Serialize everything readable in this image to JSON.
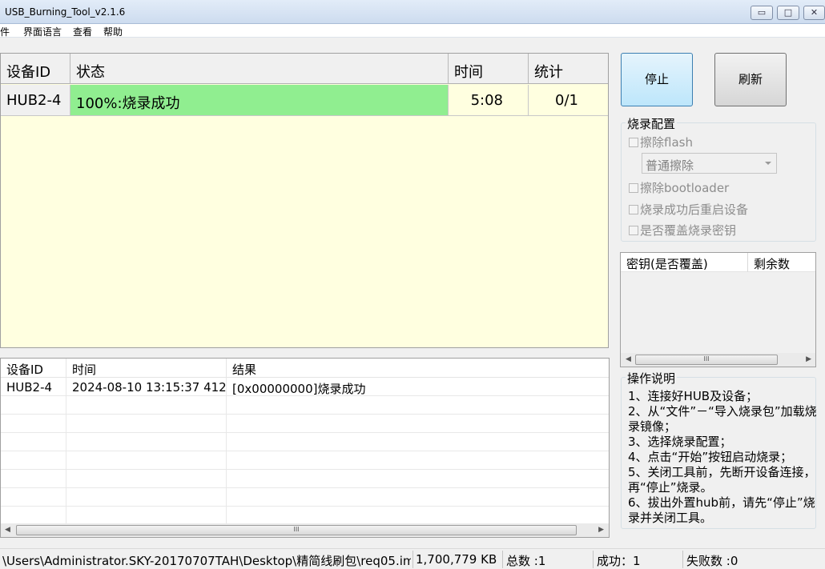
{
  "window": {
    "title": "USB_Burning_Tool_v2.1.6",
    "min_glyph": "▭",
    "max_glyph": "□",
    "close_glyph": "✕"
  },
  "menu": {
    "file": "文件",
    "language": "界面语言",
    "view": "查看",
    "help": "帮助"
  },
  "device_table": {
    "headers": {
      "id": "设备ID",
      "status": "状态",
      "time": "时间",
      "stats": "统计"
    },
    "rows": [
      {
        "id": "HUB2-4",
        "status": "100%:烧录成功",
        "time": "5:08",
        "stats": "0/1"
      }
    ]
  },
  "buttons": {
    "stop": "停止",
    "refresh": "刷新"
  },
  "burn_config": {
    "title": "烧录配置",
    "erase_flash": "擦除flash",
    "erase_mode": "普通擦除",
    "erase_bootloader": "擦除bootloader",
    "reboot_after": "烧录成功后重启设备",
    "overwrite_key": "是否覆盖烧录密钥"
  },
  "key_table": {
    "headers": {
      "key": "密钥(是否覆盖)",
      "remaining": "剩余数"
    }
  },
  "log_table": {
    "headers": {
      "id": "设备ID",
      "time": "时间",
      "result": "结果"
    },
    "rows": [
      {
        "id": "HUB2-4",
        "time": "2024-08-10 13:15:37 412",
        "result": "[0x00000000]烧录成功"
      }
    ]
  },
  "instructions": {
    "title": "操作说明",
    "lines": [
      "1、连接好HUB及设备；",
      "2、从“文件”－“导入烧录包”加载烧录镜像；",
      "3、选择烧录配置；",
      "4、点击“开始”按钮启动烧录；",
      "5、关闭工具前，先断开设备连接，再“停止”烧录。",
      "6、拔出外置hub前，请先“停止”烧录并关闭工具。"
    ]
  },
  "statusbar": {
    "path": "\\Users\\Administrator.SKY-20170707TAH\\Desktop\\精简线刷包\\req05.img",
    "size": "1,700,779 KB",
    "total": "总数 :1",
    "success": "成功：1",
    "failed": "失败数 :0"
  },
  "scroll_glyph": "III"
}
